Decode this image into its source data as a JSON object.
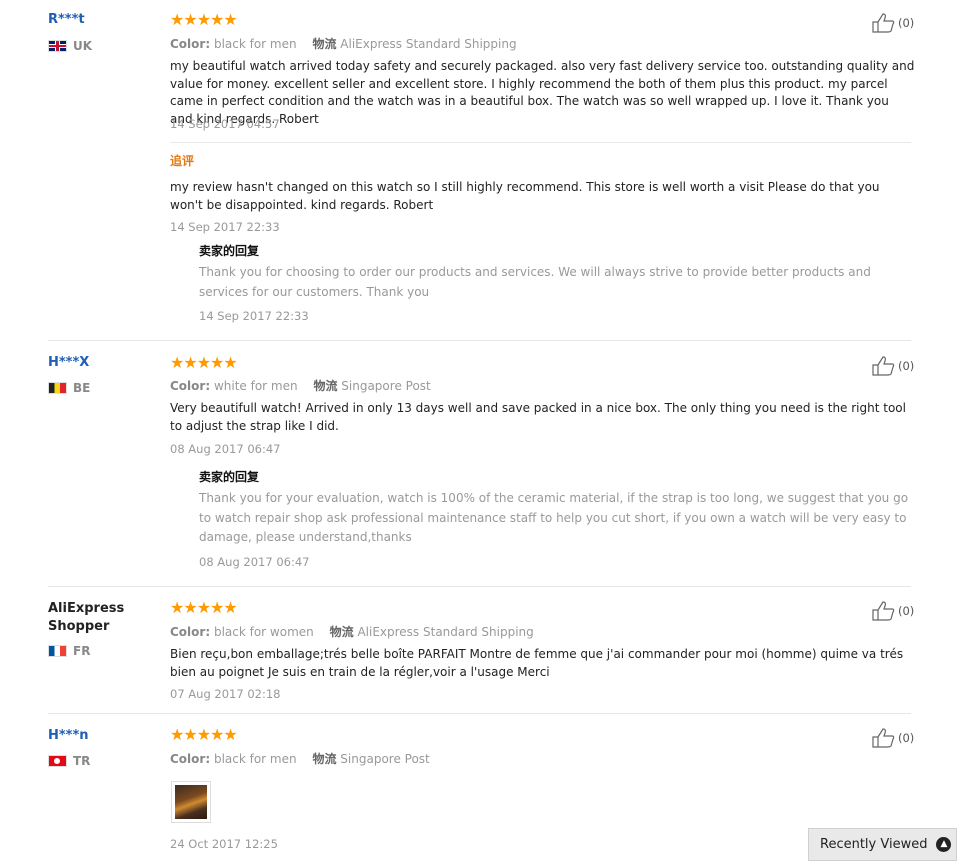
{
  "reviews": [
    {
      "user": "R***t",
      "country": "UK",
      "stars": "★★★★★",
      "color_label": "Color:",
      "color_value": "black for men",
      "shipping_label": "物流",
      "shipping_value": "AliExpress Standard Shipping",
      "text": "my beautiful watch arrived today safety and securely packaged. also very fast delivery service too. outstanding quality and value for money. excellent seller and excellent store. I highly recommend the both of them plus this product. my parcel came in perfect condition and the watch was in a beautiful box. The watch was so well wrapped up. I love it. Thank you and kind regards. Robert",
      "date": "14 Sep 2017 04:57",
      "likes": "(0)",
      "followup": {
        "label": "追评",
        "text": "my review hasn't changed on this watch so I still highly recommend. This store is well worth a visit Please do that you won't be disappointed. kind regards. Robert",
        "date": "14 Sep 2017 22:33"
      },
      "reply": {
        "title": "卖家的回复",
        "text": "Thank you for choosing to order our products and services. We will always strive to provide better products and services for our customers. Thank you",
        "date": "14 Sep 2017 22:33"
      }
    },
    {
      "user": "H***X",
      "country": "BE",
      "stars": "★★★★★",
      "color_label": "Color:",
      "color_value": "white for men",
      "shipping_label": "物流",
      "shipping_value": "Singapore Post",
      "text": "Very beautifull watch! Arrived in only 13 days well and save packed in a nice box. The only thing you need is the right tool to adjust the strap like I did.",
      "date": "08 Aug 2017 06:47",
      "likes": "(0)",
      "reply": {
        "title": "卖家的回复",
        "text": "Thank you for your evaluation, watch is 100% of the ceramic material, if the strap is too long, we suggest that you go to watch repair shop ask professional maintenance staff to help you cut short, if you own a watch will be very easy to damage, please understand,thanks",
        "date": "08 Aug 2017 06:47"
      }
    },
    {
      "user": "AliExpress Shopper",
      "country": "FR",
      "stars": "★★★★★",
      "color_label": "Color:",
      "color_value": "black for women",
      "shipping_label": "物流",
      "shipping_value": "AliExpress Standard Shipping",
      "text": "Bien reçu,bon emballage;trés belle boîte PARFAIT Montre de femme que j'ai commander pour moi (homme) quime va trés bien au poignet Je suis en train de la régler,voir a l'usage Merci",
      "date": "07 Aug 2017 02:18",
      "likes": "(0)"
    },
    {
      "user": "H***n",
      "country": "TR",
      "stars": "★★★★★",
      "color_label": "Color:",
      "color_value": "black for men",
      "shipping_label": "物流",
      "shipping_value": "Singapore Post",
      "date": "24 Oct 2017 12:25",
      "likes": "(0)"
    }
  ],
  "recently_viewed": {
    "label": "Recently Viewed",
    "icon": "chevron-up-icon"
  }
}
